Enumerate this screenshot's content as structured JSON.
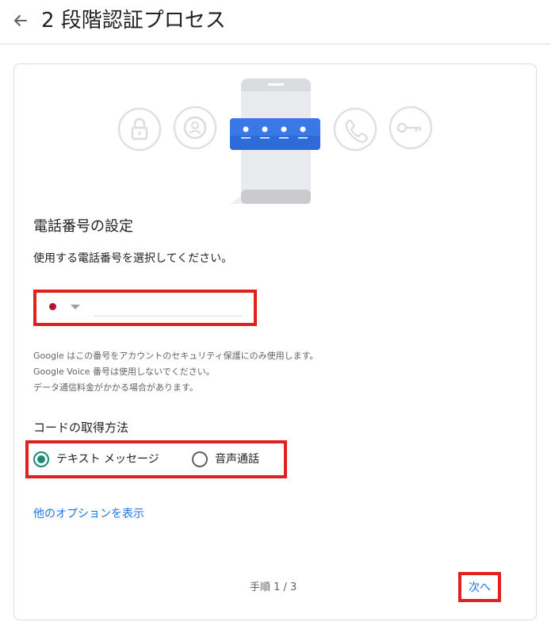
{
  "header": {
    "title": "2 段階認証プロセス",
    "back_icon": "arrow-back-icon"
  },
  "illustration": {
    "icons": [
      "lock-icon",
      "account-icon",
      "phone-icon",
      "key-icon"
    ],
    "accent_color": "#3b78e7"
  },
  "setup": {
    "title": "電話番号の設定",
    "instruction": "使用する電話番号を選択してください。"
  },
  "phone": {
    "country_flag_color": "#b3122d",
    "value": "",
    "placeholder": ""
  },
  "notes": [
    "Google はこの番号をアカウントのセキュリティ保護にのみ使用します。",
    "Google Voice 番号は使用しないでください。",
    "データ通信料金がかかる場合があります。"
  ],
  "method": {
    "title": "コードの取得方法",
    "options": [
      {
        "label": "テキスト メッセージ",
        "selected": true
      },
      {
        "label": "音声通話",
        "selected": false
      }
    ]
  },
  "links": {
    "more_options": "他のオプションを表示"
  },
  "footer": {
    "step": "手順 1 / 3",
    "next_label": "次へ"
  },
  "colors": {
    "link": "#1a73e8",
    "radio_selected": "#1a8a74",
    "highlight_box": "#e1211f"
  }
}
